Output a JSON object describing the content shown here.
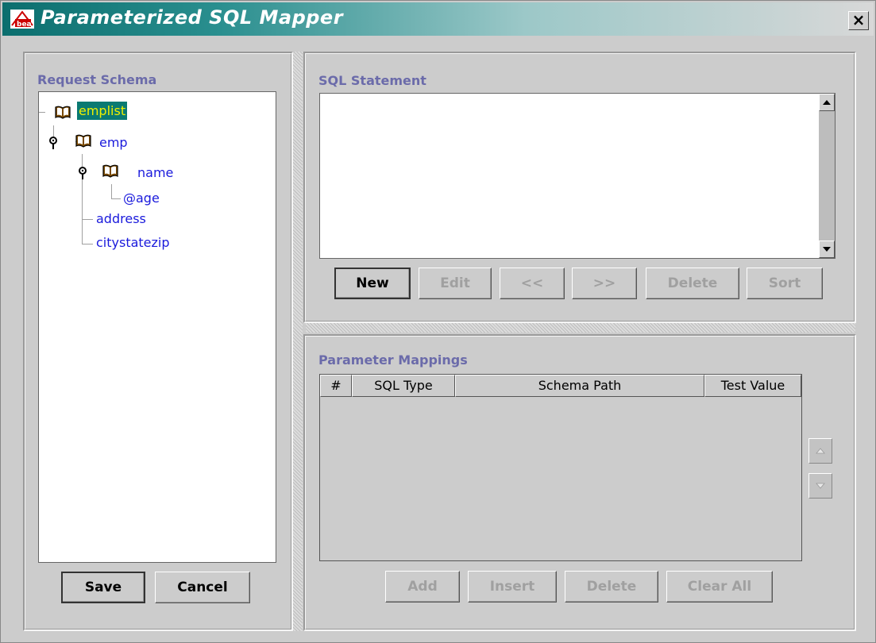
{
  "window": {
    "title": "Parameterized SQL Mapper",
    "close_glyph": "×"
  },
  "left": {
    "section_label": "Request Schema",
    "tree": [
      {
        "label": "emplist",
        "selected": true
      },
      {
        "label": "emp"
      },
      {
        "label": "name"
      },
      {
        "label": "@age"
      },
      {
        "label": "address"
      },
      {
        "label": "citystatezip"
      }
    ],
    "save_label": "Save",
    "cancel_label": "Cancel"
  },
  "sql": {
    "section_label": "SQL Statement",
    "statement": "",
    "buttons": {
      "new": "New",
      "edit": "Edit",
      "prev": "<<",
      "next": ">>",
      "delete": "Delete",
      "sort": "Sort"
    }
  },
  "mappings": {
    "section_label": "Parameter Mappings",
    "columns": [
      "#",
      "SQL Type",
      "Schema Path",
      "Test Value"
    ],
    "rows": [],
    "buttons": {
      "add": "Add",
      "insert": "Insert",
      "delete": "Delete",
      "clear_all": "Clear All"
    }
  },
  "colors": {
    "selection_bg": "#0a7a72",
    "selection_text": "#f0f000",
    "section_label": "#6b6baa",
    "tree_text": "#1a1adc"
  }
}
